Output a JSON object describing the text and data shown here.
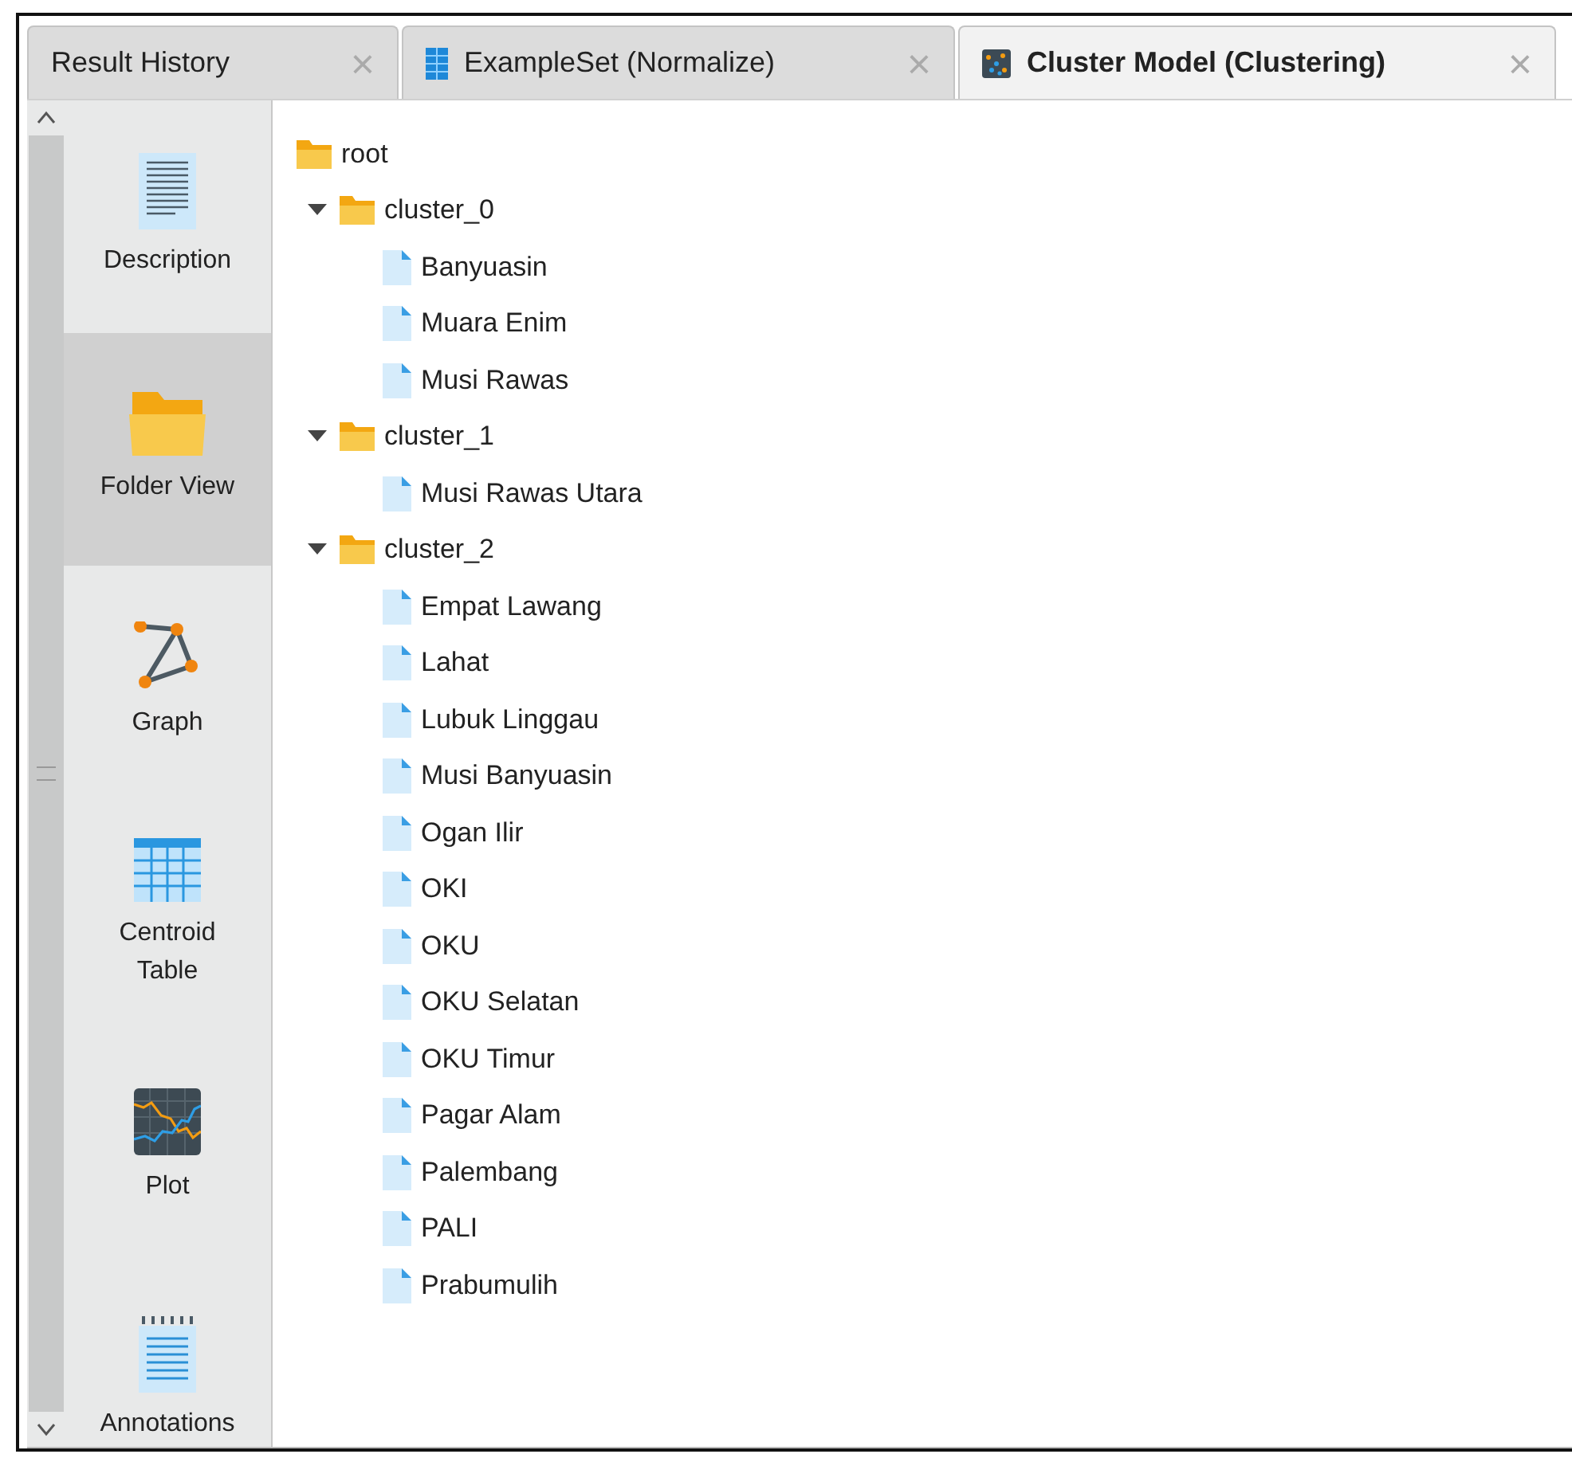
{
  "tabs": [
    {
      "label": "Result History",
      "kind": "none",
      "selected": false,
      "close": "×"
    },
    {
      "label": "ExampleSet (Normalize)",
      "kind": "table",
      "selected": false,
      "close": "×"
    },
    {
      "label": "Cluster Model (Clustering)",
      "kind": "cluster",
      "selected": true,
      "close": "×"
    }
  ],
  "sidebar": {
    "items": [
      {
        "label": "Description",
        "kind": "document",
        "selected": false
      },
      {
        "label": "Folder View",
        "kind": "folder",
        "selected": true
      },
      {
        "label": "Graph",
        "kind": "graph",
        "selected": false
      },
      {
        "label": "Centroid Table",
        "kind": "table",
        "selected": false
      },
      {
        "label": "Plot",
        "kind": "plot",
        "selected": false
      },
      {
        "label": "Annotations",
        "kind": "notes",
        "selected": false
      }
    ]
  },
  "tree": {
    "label": "root",
    "kind": "folder",
    "children": [
      {
        "label": "cluster_0",
        "kind": "folder",
        "expanded": true,
        "children": [
          {
            "label": "Banyuasin",
            "kind": "file"
          },
          {
            "label": "Muara Enim",
            "kind": "file"
          },
          {
            "label": "Musi Rawas",
            "kind": "file"
          }
        ]
      },
      {
        "label": "cluster_1",
        "kind": "folder",
        "expanded": true,
        "children": [
          {
            "label": "Musi Rawas Utara",
            "kind": "file"
          }
        ]
      },
      {
        "label": "cluster_2",
        "kind": "folder",
        "expanded": true,
        "children": [
          {
            "label": "Empat Lawang",
            "kind": "file"
          },
          {
            "label": "Lahat",
            "kind": "file"
          },
          {
            "label": "Lubuk Linggau",
            "kind": "file"
          },
          {
            "label": "Musi Banyuasin",
            "kind": "file"
          },
          {
            "label": "Ogan Ilir",
            "kind": "file"
          },
          {
            "label": "OKI",
            "kind": "file"
          },
          {
            "label": "OKU",
            "kind": "file"
          },
          {
            "label": "OKU Selatan",
            "kind": "file"
          },
          {
            "label": "OKU Timur",
            "kind": "file"
          },
          {
            "label": "Pagar Alam",
            "kind": "file"
          },
          {
            "label": "Palembang",
            "kind": "file"
          },
          {
            "label": "PALI",
            "kind": "file"
          },
          {
            "label": "Prabumulih",
            "kind": "file"
          }
        ]
      }
    ]
  }
}
